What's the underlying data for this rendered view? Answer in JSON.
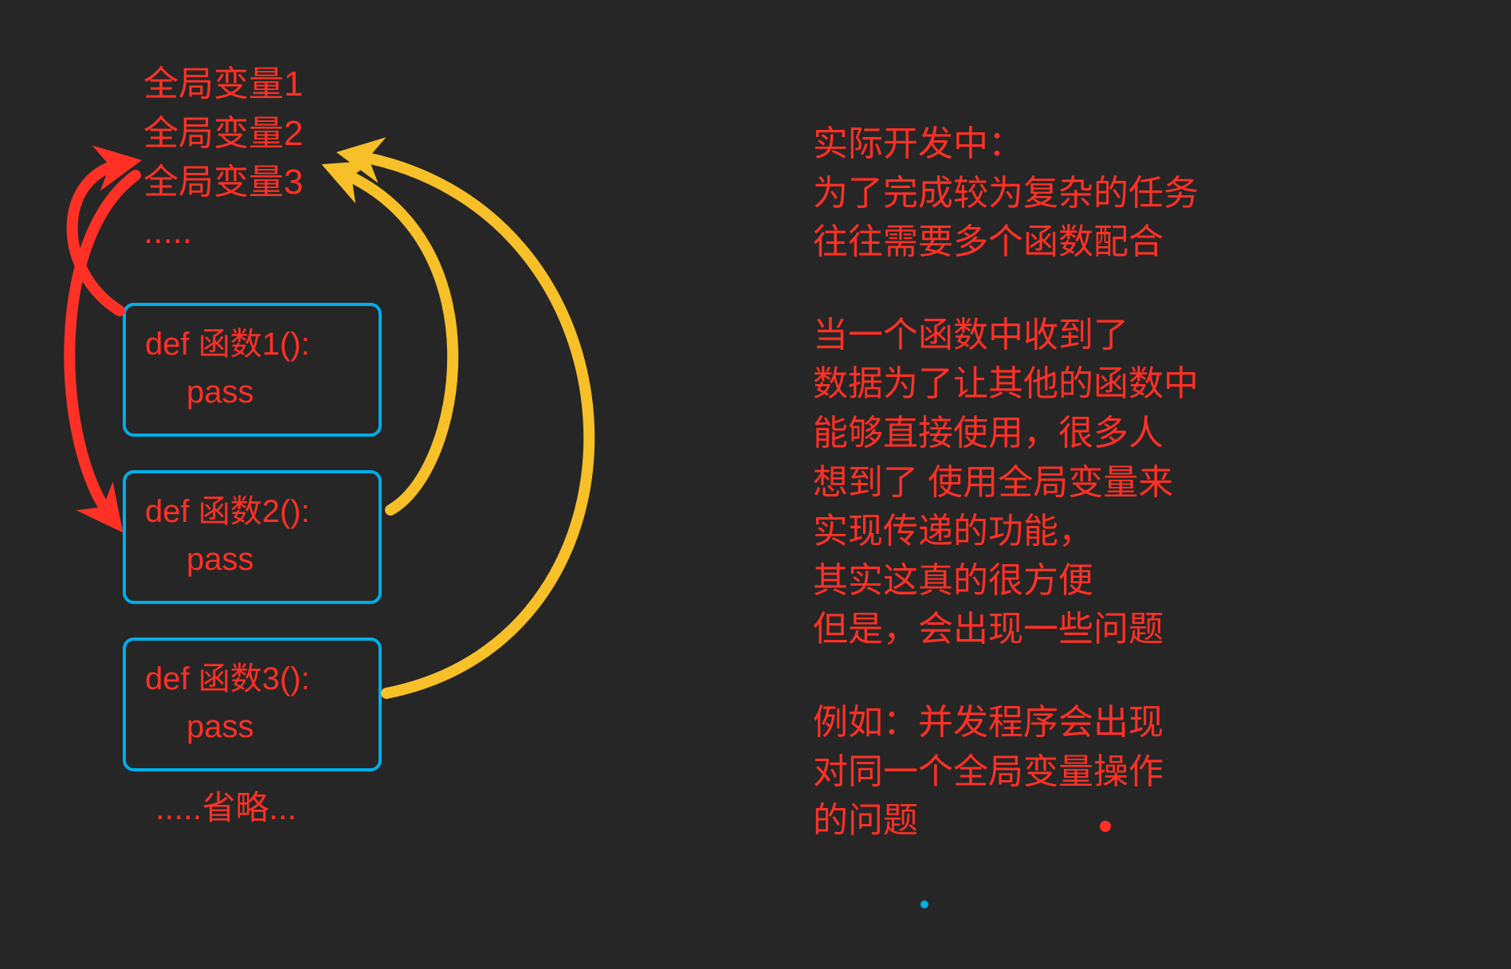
{
  "globals": {
    "var1": "全局变量1",
    "var2": "全局变量2",
    "var3": "全局变量3",
    "ellipsis": "....."
  },
  "functions": {
    "f1_def": "def 函数1():",
    "f1_body": "pass",
    "f2_def": "def 函数2():",
    "f2_body": "pass",
    "f3_def": "def 函数3():",
    "f3_body": "pass"
  },
  "omit": ".....省略...",
  "explanation": {
    "p1_l1": "实际开发中：",
    "p1_l2": "为了完成较为复杂的任务",
    "p1_l3": "往往需要多个函数配合",
    "p2_l1": "当一个函数中收到了",
    "p2_l2": "数据为了让其他的函数中",
    "p2_l3": "能够直接使用，很多人",
    "p2_l4": "想到了 使用全局变量来",
    "p2_l5": "实现传递的功能，",
    "p2_l6": "其实这真的很方便",
    "p2_l7": "但是，会出现一些问题",
    "p3_l1": "例如：并发程序会出现",
    "p3_l2": "对同一个全局变量操作",
    "p3_l3": "的问题"
  },
  "colors": {
    "red": "#ff3126",
    "yellow": "#f7c028",
    "blue": "#00aee8",
    "bg": "#262626"
  }
}
